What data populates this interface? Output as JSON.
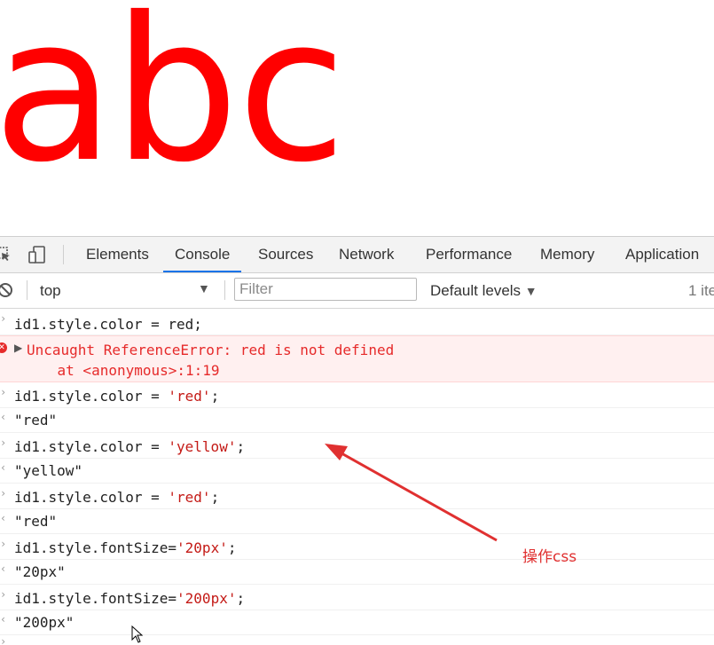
{
  "page": {
    "big_text": "abc",
    "text_color": "#ff0000"
  },
  "devtools": {
    "tabs": [
      {
        "label": "Elements",
        "active": false
      },
      {
        "label": "Console",
        "active": true
      },
      {
        "label": "Sources",
        "active": false
      },
      {
        "label": "Network",
        "active": false
      },
      {
        "label": "Performance",
        "active": false
      },
      {
        "label": "Memory",
        "active": false
      },
      {
        "label": "Application",
        "active": false
      }
    ],
    "accent_color": "#1a73e8"
  },
  "filterbar": {
    "context": "top",
    "filter_placeholder": "Filter",
    "levels": "Default levels",
    "items_count": "1 ite"
  },
  "console": {
    "lines": [
      {
        "input": "id1.style.color = red;"
      },
      {
        "error": "Uncaught ReferenceError: red is not defined",
        "error_location": "    at <anonymous>:1:19"
      },
      {
        "input_pre": "id1.style.color = ",
        "input_str": "'red'",
        "input_post": ";",
        "output": "\"red\""
      },
      {
        "input_pre": "id1.style.color = ",
        "input_str": "'yellow'",
        "input_post": ";",
        "output": "\"yellow\""
      },
      {
        "input_pre": "id1.style.color = ",
        "input_str": "'red'",
        "input_post": ";",
        "output": "\"red\""
      },
      {
        "input_pre": "id1.style.fontSize=",
        "input_str": "'20px'",
        "input_post": ";",
        "output": "\"20px\""
      },
      {
        "input_pre": "id1.style.fontSize=",
        "input_str": "'200px'",
        "input_post": ";",
        "output": "\"200px\""
      }
    ]
  },
  "annotation": {
    "label": "操作css",
    "color": "#e03030"
  }
}
